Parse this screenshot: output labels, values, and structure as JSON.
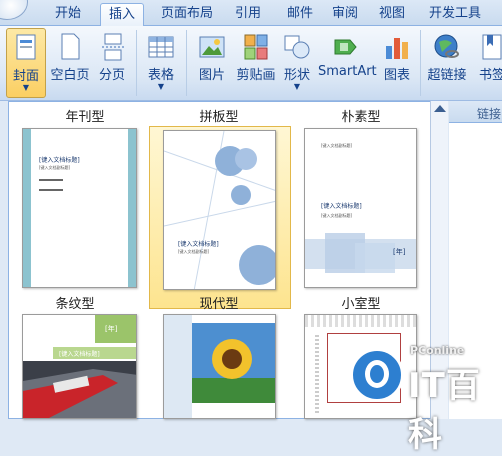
{
  "tabs": [
    "开始",
    "插入",
    "页面布局",
    "引用",
    "邮件",
    "审阅",
    "视图",
    "开发工具"
  ],
  "ribbon": {
    "cover": "封面",
    "blank_page": "空白页",
    "page_break": "分页",
    "table": "表格",
    "picture": "图片",
    "clipart": "剪贴画",
    "shapes": "形状",
    "smartart": "SmartArt",
    "chart": "图表",
    "hyperlink": "超链接",
    "bookmark": "书签",
    "group_links": "链接"
  },
  "gallery": {
    "captions": [
      "年刊型",
      "拼板型",
      "朴素型",
      "条纹型",
      "现代型",
      "小室型"
    ],
    "placeholder_title": "[键入文档标题]",
    "placeholder_subtitle": "[键入文档副标题]",
    "year_text": "[年]",
    "stripe_year_text": "[年]"
  },
  "watermark": {
    "small": "PConline",
    "big": "IT百科"
  },
  "colors": {
    "accent": "#15428b",
    "selection": "#fbcf63"
  }
}
